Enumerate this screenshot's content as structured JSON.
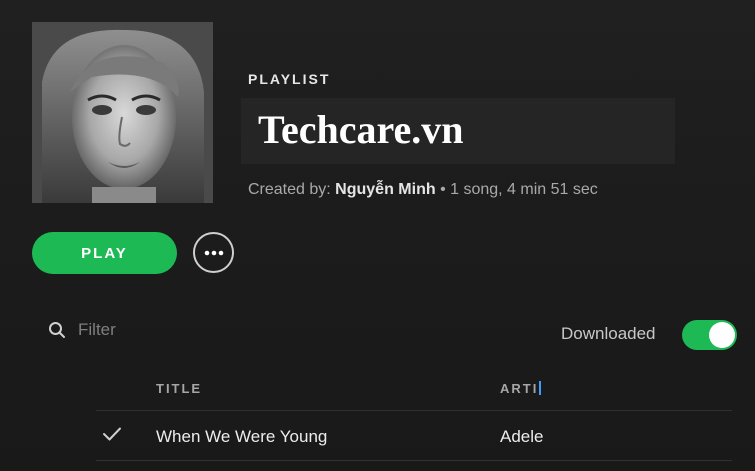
{
  "playlist": {
    "type_label": "PLAYLIST",
    "title": "Techcare.vn",
    "created_by_label": "Created by:",
    "owner": "Nguyễn Minh",
    "stats": "• 1 song, 4 min 51 sec",
    "cover_alt": "Album cover art"
  },
  "controls": {
    "play_label": "PLAY",
    "more_icon": "more-horizontal-icon"
  },
  "filter": {
    "placeholder": "Filter",
    "value": "",
    "icon": "search-icon"
  },
  "downloaded": {
    "label": "Downloaded",
    "enabled": true
  },
  "table": {
    "columns": [
      "TITLE",
      "ARTI"
    ],
    "rows": [
      {
        "downloaded_icon": "check-icon",
        "title": "When We Were Young",
        "artist": "Adele"
      }
    ]
  },
  "colors": {
    "accent": "#1db954",
    "background": "#1b1b1b"
  }
}
